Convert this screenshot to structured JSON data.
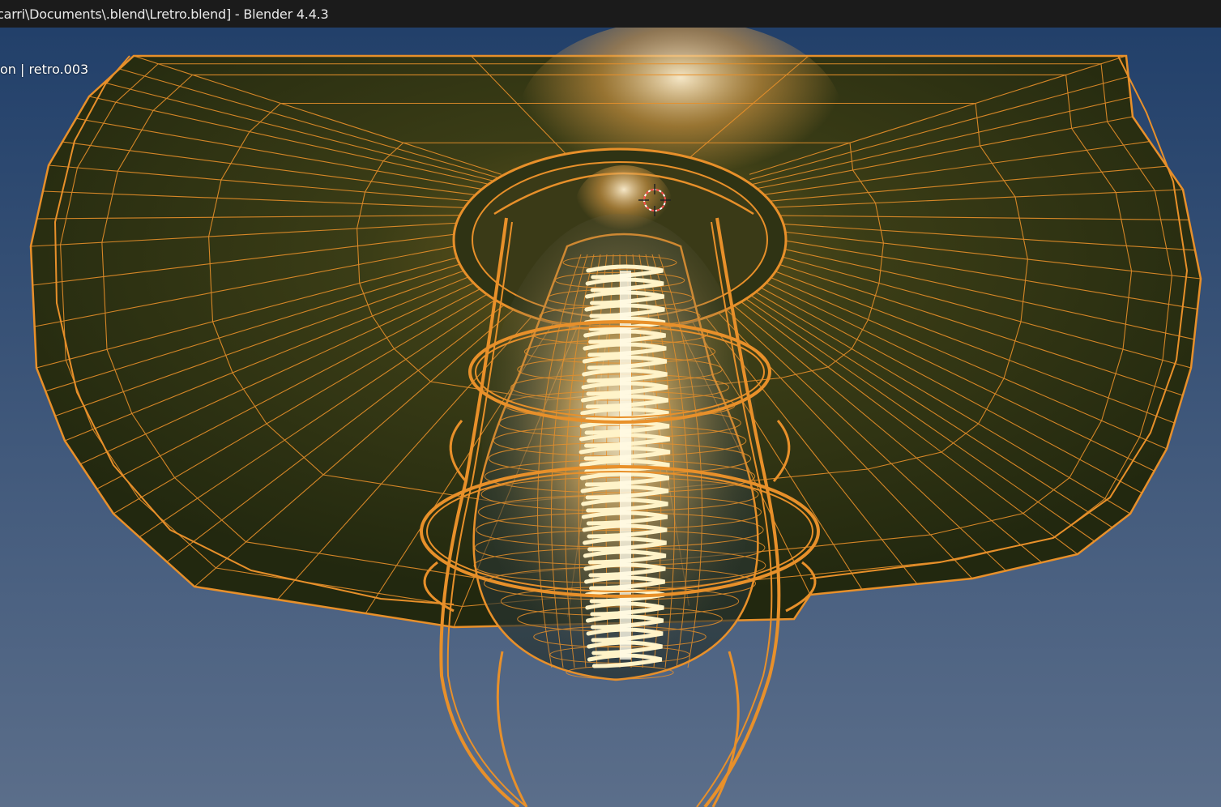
{
  "window": {
    "title": "carri\\Documents\\.blend\\Lretro.blend] - Blender 4.4.3"
  },
  "viewport": {
    "info_text": "on | retro.003",
    "colors": {
      "sky_top": "#2b4566",
      "sky_bottom": "#5a6f8c",
      "wire": "#e8902a",
      "shade": "#2a2e12",
      "glow": "#ffe7b0"
    },
    "cursor_icon": "3d-cursor-icon"
  }
}
